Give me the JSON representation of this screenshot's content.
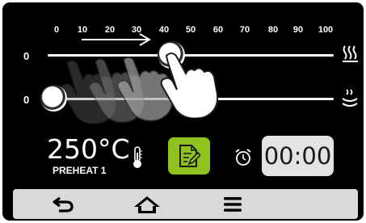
{
  "scale": {
    "ticks": [
      "0",
      "10",
      "20",
      "30",
      "40",
      "50",
      "60",
      "70",
      "80",
      "90",
      "100"
    ]
  },
  "sliders": [
    {
      "id": "top-heat",
      "label": "0",
      "value": 40,
      "icon": "top-heating-element-icon"
    },
    {
      "id": "steam",
      "label": "0",
      "value": 0,
      "icon": "steam-icon"
    }
  ],
  "info": {
    "temperature": "250°C",
    "mode": "PREHEAT 1",
    "timer": "00:00"
  },
  "icons": {
    "thermometer": "thermometer-icon",
    "edit": "edit-document-icon",
    "alarm": "alarm-clock-icon",
    "back": "back-arrow-icon",
    "home": "home-icon",
    "menu": "hamburger-menu-icon"
  },
  "colors": {
    "background": "#000000",
    "accent": "#8fc21f",
    "timer_bg": "#e3e3e3",
    "nav_bg": "#d9d9d9"
  }
}
